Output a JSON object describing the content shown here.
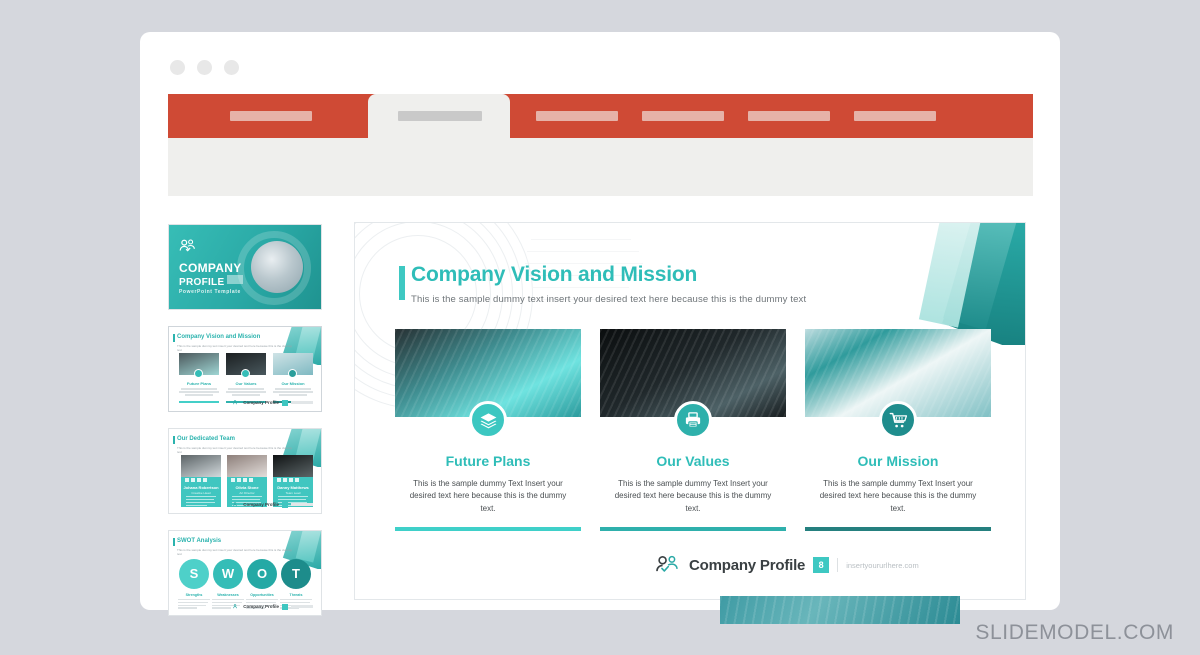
{
  "browser": {
    "window_dots": [
      "dot-1",
      "dot-2",
      "dot-3"
    ],
    "tabs": [
      {
        "name": "tab-1",
        "active": false
      },
      {
        "name": "tab-2",
        "active": true
      },
      {
        "name": "tab-3",
        "active": false
      },
      {
        "name": "tab-4",
        "active": false
      },
      {
        "name": "tab-5",
        "active": false
      },
      {
        "name": "tab-6",
        "active": false
      }
    ],
    "tab_bar_color": "#cf4a35",
    "toolbar_color": "#efefed"
  },
  "sidebar": {
    "thumbnails": [
      {
        "index": "1",
        "kind": "cover",
        "line1": "COMPANY",
        "line2": "PROFILE",
        "line3": "PowerPoint Template",
        "selected": false
      },
      {
        "index": "2",
        "kind": "vision",
        "title": "Company Vision and Mission",
        "subtitle": "This is the sample dummy text insert your desired text here because this is the dummy text",
        "columns": [
          "Future Plans",
          "Our Values",
          "Our Mission"
        ],
        "footer_brand": "Company Profile",
        "selected": true
      },
      {
        "index": "3",
        "kind": "team",
        "title": "Our Dedicated Team",
        "subtitle": "This is the sample dummy text insert your desired text here because this is the dummy text",
        "members": [
          {
            "name": "Johana Robertson",
            "role": "Creative Head"
          },
          {
            "name": "Olivia Stone",
            "role": "Art Director"
          },
          {
            "name": "Danny Matthews",
            "role": "Team Lead"
          }
        ],
        "footer_brand": "Company Profile",
        "selected": false
      },
      {
        "index": "4",
        "kind": "swot",
        "title": "SWOT Analysis",
        "subtitle": "This is the sample dummy text insert your desired text here because this is the dummy text",
        "letters": [
          "S",
          "W",
          "O",
          "T"
        ],
        "labels": [
          "Strengths",
          "Weaknesses",
          "Opportunities",
          "Threats"
        ],
        "footer_brand": "Company Profile",
        "selected": false
      }
    ]
  },
  "slide": {
    "title": "Company Vision and Mission",
    "subtitle": "This is the sample dummy text insert your desired text here because this is the dummy text",
    "columns": [
      {
        "heading": "Future Plans",
        "body": "This is the sample dummy Text Insert your desired text here because this is the dummy text.",
        "icon": "layers-icon",
        "icon_color": "#3cc7c1",
        "rule_color": "#3fd0c9",
        "photo_alt": "business-meeting-photo"
      },
      {
        "heading": "Our Values",
        "body": "This is the sample dummy Text Insert your desired text here because this is the dummy text.",
        "icon": "printer-icon",
        "icon_color": "#2eb0ab",
        "rule_color": "#2fb0ac",
        "photo_alt": "hand-holding-phone-photo"
      },
      {
        "heading": "Our Mission",
        "body": "This is the sample dummy Text Insert your desired text here because this is the dummy text.",
        "icon": "shopping-cart-icon",
        "icon_color": "#1f8d8d",
        "rule_color": "#25807f",
        "photo_alt": "modern-architecture-photo"
      }
    ],
    "footer": {
      "brand": "Company Profile",
      "page_badge": "8",
      "url": "insertyoururlhere.com"
    },
    "accent_color": "#2fbdb8"
  },
  "watermark": "SLIDEMODEL.COM"
}
